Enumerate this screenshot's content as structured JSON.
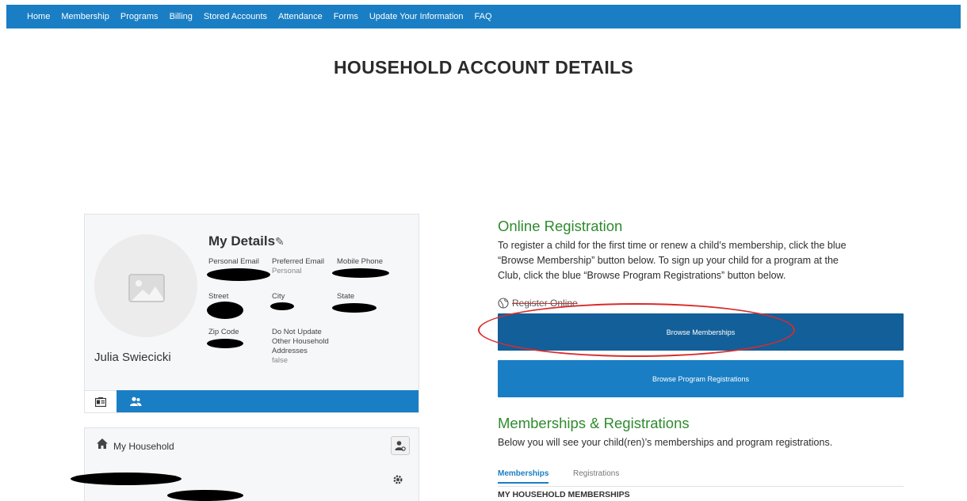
{
  "nav": {
    "items": [
      "Home",
      "Membership",
      "Programs",
      "Billing",
      "Stored Accounts",
      "Attendance",
      "Forms",
      "Update Your Information",
      "FAQ"
    ]
  },
  "page_title": "HOUSEHOLD ACCOUNT DETAILS",
  "details": {
    "heading": "My Details",
    "user_name": "Julia Swiecicki",
    "fields": {
      "personal_email_label": "Personal Email",
      "preferred_email_label": "Preferred Email",
      "preferred_email_value": "Personal",
      "mobile_phone_label": "Mobile Phone",
      "street_label": "Street",
      "city_label": "City",
      "state_label": "State",
      "zip_label": "Zip Code",
      "do_not_update_label_1": "Do Not Update",
      "do_not_update_label_2": "Other Household",
      "do_not_update_label_3": "Addresses",
      "do_not_update_value": "false"
    }
  },
  "household": {
    "title": "My Household"
  },
  "online_registration": {
    "heading": "Online Registration",
    "line1": "To register a child for the first time or renew a child’s membership, click the blue",
    "line2": "“Browse Membership” button below. To sign up your child for a program at the",
    "line3": "Club, click the blue “Browse Program Registrations” button below.",
    "register_online": "Register Online",
    "browse_memberships": "Browse Memberships",
    "browse_programs": "Browse Program Registrations"
  },
  "memberships_section": {
    "heading": "Memberships & Registrations",
    "description": "Below you will see your child(ren)’s memberships and program registrations.",
    "tabs": [
      "Memberships",
      "Registrations"
    ],
    "subheading": "MY HOUSEHOLD MEMBERSHIPS"
  },
  "colors": {
    "nav_blue": "#1a7ec4",
    "button_dark_blue": "#135f99",
    "heading_green": "#2f8b2f",
    "annotation_red": "#d92b2b"
  }
}
